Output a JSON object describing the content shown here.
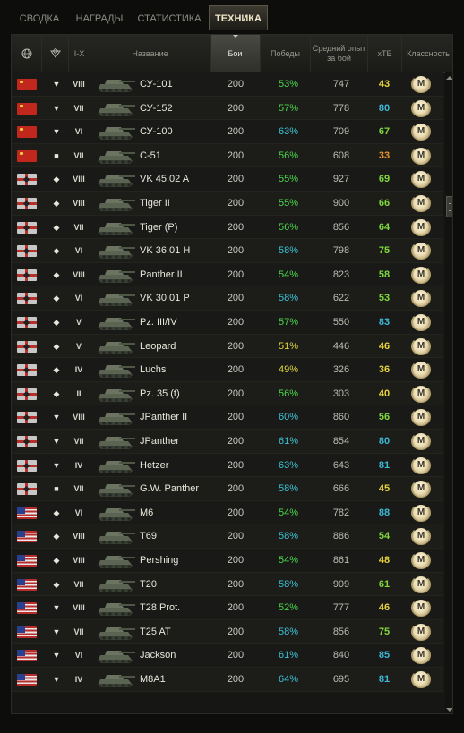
{
  "tabs": [
    {
      "label": "СВОДКА",
      "active": false
    },
    {
      "label": "НАГРАДЫ",
      "active": false
    },
    {
      "label": "СТАТИСТИКА",
      "active": false
    },
    {
      "label": "ТЕХНИКА",
      "active": true
    }
  ],
  "header": {
    "nation_icon": "globe-icon",
    "type_icon": "vehicle-type-icon",
    "tier": "I-X",
    "name": "Название",
    "battles": "Бои",
    "wins": "Победы",
    "avg_xp": "Средний опыт за бой",
    "xte": "xTE",
    "mastery": "Классность"
  },
  "colors": {
    "win_green": "#4bd84b",
    "win_cyan": "#3cc6d6",
    "win_yellow": "#e0d83c",
    "xte_green": "#7fd83c",
    "xte_cyan": "#3cb8d6",
    "xte_yellow": "#e8d43c",
    "xte_orange": "#e8942c"
  },
  "rows": [
    {
      "nation": "ussr",
      "type": "▼",
      "tier": "VIII",
      "name": "СУ-101",
      "battles": "200",
      "wins": "53%",
      "wc": "green",
      "xp": "747",
      "xte": "43",
      "xc": "yellow",
      "mastery": "M"
    },
    {
      "nation": "ussr",
      "type": "▼",
      "tier": "VII",
      "name": "СУ-152",
      "battles": "200",
      "wins": "57%",
      "wc": "green",
      "xp": "778",
      "xte": "80",
      "xc": "cyan",
      "mastery": "M"
    },
    {
      "nation": "ussr",
      "type": "▼",
      "tier": "VI",
      "name": "СУ-100",
      "battles": "200",
      "wins": "63%",
      "wc": "cyan",
      "xp": "709",
      "xte": "67",
      "xc": "green",
      "mastery": "M"
    },
    {
      "nation": "ussr",
      "type": "■",
      "tier": "VII",
      "name": "С-51",
      "battles": "200",
      "wins": "56%",
      "wc": "green",
      "xp": "608",
      "xte": "33",
      "xc": "orange",
      "mastery": "M"
    },
    {
      "nation": "germany",
      "type": "◆",
      "tier": "VIII",
      "name": "VK 45.02 A",
      "battles": "200",
      "wins": "55%",
      "wc": "green",
      "xp": "927",
      "xte": "69",
      "xc": "green",
      "mastery": "M"
    },
    {
      "nation": "germany",
      "type": "◆",
      "tier": "VIII",
      "name": "Tiger II",
      "battles": "200",
      "wins": "55%",
      "wc": "green",
      "xp": "900",
      "xte": "66",
      "xc": "green",
      "mastery": "M"
    },
    {
      "nation": "germany",
      "type": "◆",
      "tier": "VII",
      "name": "Tiger (P)",
      "battles": "200",
      "wins": "56%",
      "wc": "green",
      "xp": "856",
      "xte": "64",
      "xc": "green",
      "mastery": "M"
    },
    {
      "nation": "germany",
      "type": "◆",
      "tier": "VI",
      "name": "VK 36.01 H",
      "battles": "200",
      "wins": "58%",
      "wc": "cyan",
      "xp": "798",
      "xte": "75",
      "xc": "green",
      "mastery": "M"
    },
    {
      "nation": "germany",
      "type": "◆",
      "tier": "VIII",
      "name": "Panther II",
      "battles": "200",
      "wins": "54%",
      "wc": "green",
      "xp": "823",
      "xte": "58",
      "xc": "green",
      "mastery": "M"
    },
    {
      "nation": "germany",
      "type": "◆",
      "tier": "VI",
      "name": "VK 30.01 P",
      "battles": "200",
      "wins": "58%",
      "wc": "cyan",
      "xp": "622",
      "xte": "53",
      "xc": "green",
      "mastery": "M"
    },
    {
      "nation": "germany",
      "type": "◆",
      "tier": "V",
      "name": "Pz. III/IV",
      "battles": "200",
      "wins": "57%",
      "wc": "green",
      "xp": "550",
      "xte": "83",
      "xc": "cyan",
      "mastery": "M"
    },
    {
      "nation": "germany",
      "type": "◆",
      "tier": "V",
      "name": "Leopard",
      "battles": "200",
      "wins": "51%",
      "wc": "yellow",
      "xp": "446",
      "xte": "46",
      "xc": "yellow",
      "mastery": "M"
    },
    {
      "nation": "germany",
      "type": "◆",
      "tier": "IV",
      "name": "Luchs",
      "battles": "200",
      "wins": "49%",
      "wc": "yellow",
      "xp": "326",
      "xte": "36",
      "xc": "yellow",
      "mastery": "M"
    },
    {
      "nation": "germany",
      "type": "◆",
      "tier": "II",
      "name": "Pz. 35 (t)",
      "battles": "200",
      "wins": "56%",
      "wc": "green",
      "xp": "303",
      "xte": "40",
      "xc": "yellow",
      "mastery": "M"
    },
    {
      "nation": "germany",
      "type": "▼",
      "tier": "VIII",
      "name": "JPanther II",
      "battles": "200",
      "wins": "60%",
      "wc": "cyan",
      "xp": "860",
      "xte": "56",
      "xc": "green",
      "mastery": "M"
    },
    {
      "nation": "germany",
      "type": "▼",
      "tier": "VII",
      "name": "JPanther",
      "battles": "200",
      "wins": "61%",
      "wc": "cyan",
      "xp": "854",
      "xte": "80",
      "xc": "cyan",
      "mastery": "M"
    },
    {
      "nation": "germany",
      "type": "▼",
      "tier": "IV",
      "name": "Hetzer",
      "battles": "200",
      "wins": "63%",
      "wc": "cyan",
      "xp": "643",
      "xte": "81",
      "xc": "cyan",
      "mastery": "M"
    },
    {
      "nation": "germany",
      "type": "■",
      "tier": "VII",
      "name": "G.W. Panther",
      "battles": "200",
      "wins": "58%",
      "wc": "cyan",
      "xp": "666",
      "xte": "45",
      "xc": "yellow",
      "mastery": "M"
    },
    {
      "nation": "usa",
      "type": "◆",
      "tier": "VI",
      "name": "M6",
      "battles": "200",
      "wins": "54%",
      "wc": "green",
      "xp": "782",
      "xte": "88",
      "xc": "cyan",
      "mastery": "M"
    },
    {
      "nation": "usa",
      "type": "◆",
      "tier": "VIII",
      "name": "T69",
      "battles": "200",
      "wins": "58%",
      "wc": "cyan",
      "xp": "886",
      "xte": "54",
      "xc": "green",
      "mastery": "M"
    },
    {
      "nation": "usa",
      "type": "◆",
      "tier": "VIII",
      "name": "Pershing",
      "battles": "200",
      "wins": "54%",
      "wc": "green",
      "xp": "861",
      "xte": "48",
      "xc": "yellow",
      "mastery": "M"
    },
    {
      "nation": "usa",
      "type": "◆",
      "tier": "VII",
      "name": "T20",
      "battles": "200",
      "wins": "58%",
      "wc": "cyan",
      "xp": "909",
      "xte": "61",
      "xc": "green",
      "mastery": "M"
    },
    {
      "nation": "usa",
      "type": "▼",
      "tier": "VIII",
      "name": "T28 Prot.",
      "battles": "200",
      "wins": "52%",
      "wc": "green",
      "xp": "777",
      "xte": "46",
      "xc": "yellow",
      "mastery": "M"
    },
    {
      "nation": "usa",
      "type": "▼",
      "tier": "VII",
      "name": "T25 AT",
      "battles": "200",
      "wins": "58%",
      "wc": "cyan",
      "xp": "856",
      "xte": "75",
      "xc": "green",
      "mastery": "M"
    },
    {
      "nation": "usa",
      "type": "▼",
      "tier": "VI",
      "name": "Jackson",
      "battles": "200",
      "wins": "61%",
      "wc": "cyan",
      "xp": "840",
      "xte": "85",
      "xc": "cyan",
      "mastery": "M"
    },
    {
      "nation": "usa",
      "type": "▼",
      "tier": "IV",
      "name": "M8A1",
      "battles": "200",
      "wins": "64%",
      "wc": "cyan",
      "xp": "695",
      "xte": "81",
      "xc": "cyan",
      "mastery": "M"
    }
  ]
}
